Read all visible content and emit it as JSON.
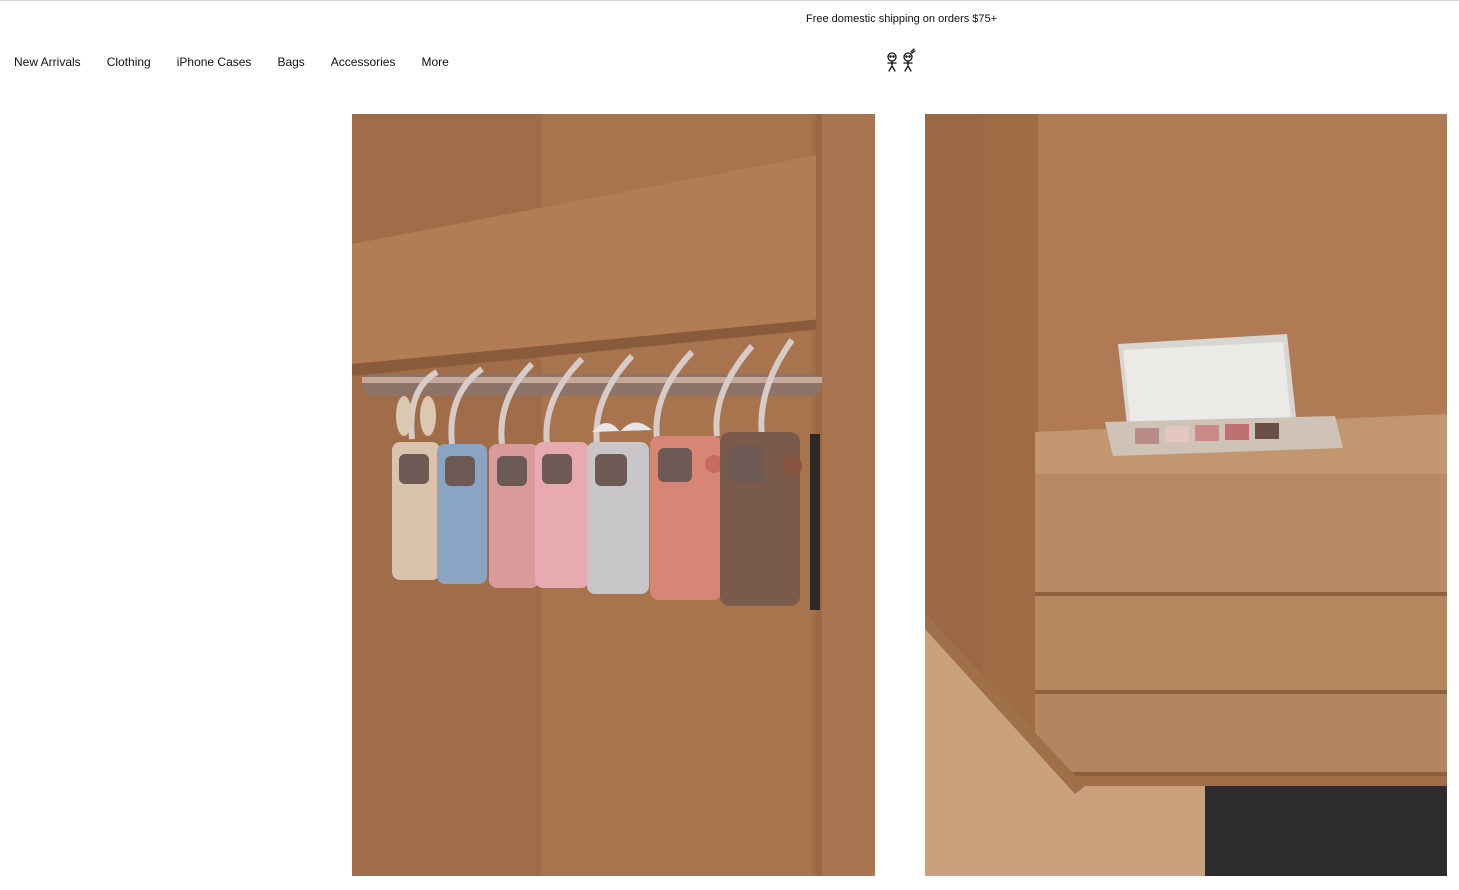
{
  "announcement": {
    "text": "Free domestic shipping on orders $75+"
  },
  "nav": {
    "items": [
      {
        "label": "New Arrivals"
      },
      {
        "label": "Clothing"
      },
      {
        "label": "iPhone Cases"
      },
      {
        "label": "Bags"
      },
      {
        "label": "Accessories"
      },
      {
        "label": "More"
      }
    ]
  },
  "logo": {
    "icon": "two-stick-figures-logo-icon"
  },
  "hero": {
    "left_image": {
      "subject": "puffer-iphone-cases-hanging-on-rail",
      "case_colors": [
        "#d9c3ac",
        "#8aa4c4",
        "#d99a9c",
        "#e7aab0",
        "#c8c6c8",
        "#d78574",
        "#7a5a4a"
      ]
    },
    "right_image": {
      "subject": "compact-palette-on-wooden-drawers"
    }
  },
  "colors": {
    "text": "#111111",
    "background": "#ffffff",
    "wood": "#a9744e"
  }
}
